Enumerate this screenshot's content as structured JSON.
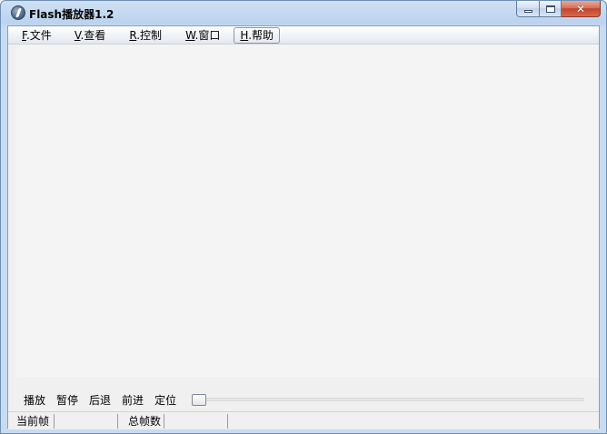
{
  "window": {
    "title": "Flash播放器1.2",
    "icon": "flash-app-icon",
    "controls": {
      "minimize_icon": "minimize-icon",
      "maximize_icon": "maximize-icon",
      "close_icon": "close-icon",
      "close_glyph": "✕"
    }
  },
  "menubar": {
    "items": [
      {
        "accel": "F",
        "label": ".文件"
      },
      {
        "accel": "V",
        "label": ".查看"
      },
      {
        "accel": "R",
        "label": ".控制"
      },
      {
        "accel": "W",
        "label": ".窗口"
      },
      {
        "accel": "H",
        "label": ".帮助"
      }
    ],
    "active_index": 4
  },
  "controls": {
    "buttons": [
      "播放",
      "暂停",
      "后退",
      "前进",
      "定位"
    ],
    "slider_position": 0
  },
  "statusbar": {
    "current_frame_label": "当前帧",
    "current_frame_value": "",
    "total_frames_label": "总帧数",
    "total_frames_value": ""
  },
  "colors": {
    "titlebar": "#bcd3ee",
    "close_button": "#c2452c",
    "client_bg": "#f0f0f0",
    "player_bg": "#f4f4f4"
  }
}
